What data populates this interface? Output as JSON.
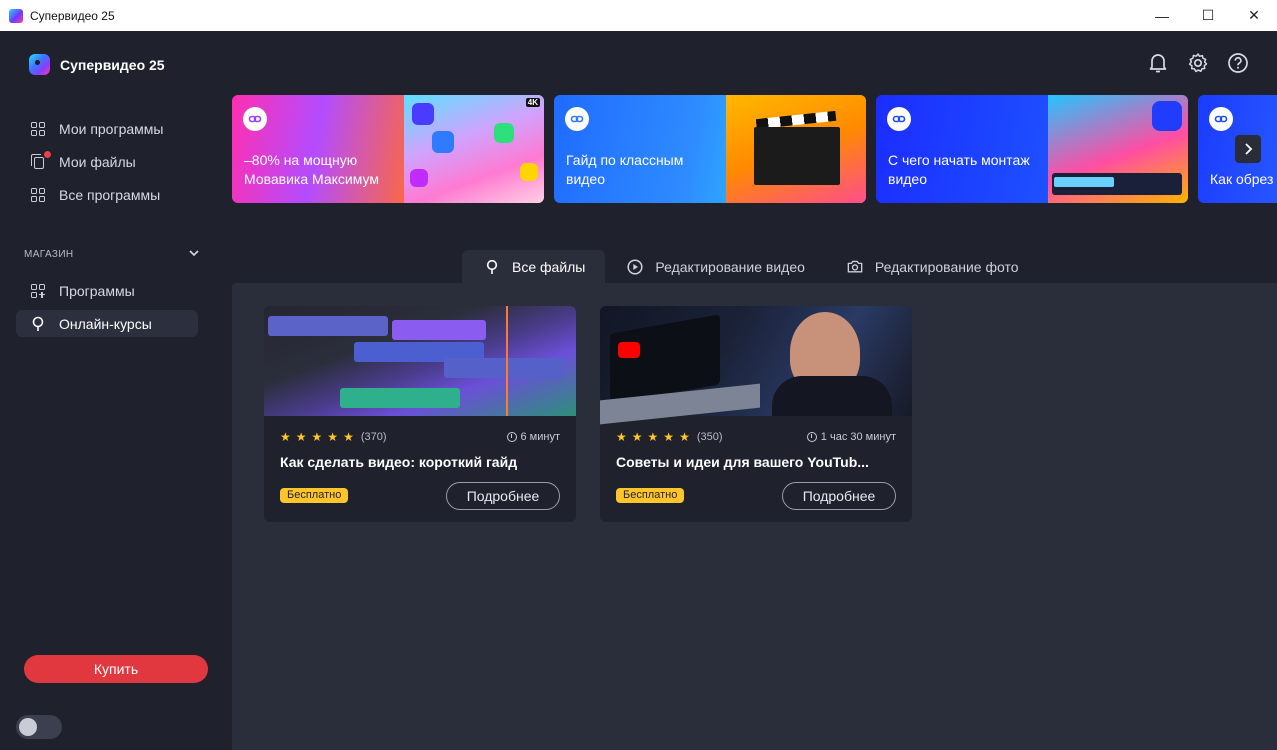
{
  "window": {
    "title": "Супервидео 25",
    "controls": {
      "minimize": "—",
      "maximize": "☐",
      "close": "✕"
    }
  },
  "brand": {
    "name": "Супервидео 25"
  },
  "sidebar": {
    "items": [
      {
        "label": "Мои программы",
        "icon": "grid-icon"
      },
      {
        "label": "Мои файлы",
        "icon": "files-icon",
        "has_notification": true
      },
      {
        "label": "Все программы",
        "icon": "grid-icon"
      }
    ],
    "store_section": {
      "label": "МАГАЗИН",
      "items": [
        {
          "label": "Программы",
          "icon": "grid-plus-icon"
        },
        {
          "label": "Онлайн-курсы",
          "icon": "lightbulb-icon",
          "active": true
        }
      ]
    },
    "buy_label": "Купить",
    "theme_toggle": {
      "on": false
    }
  },
  "header": {
    "icons": [
      "bell-icon",
      "gear-icon",
      "help-icon"
    ]
  },
  "banners": [
    {
      "text": "–80% на мощную Мовавика Максимум",
      "image_badge": "4K"
    },
    {
      "text": "Гайд по классным видео"
    },
    {
      "text": "С чего начать монтаж видео"
    },
    {
      "text": "Как обрез"
    }
  ],
  "tabs": [
    {
      "label": "Все файлы",
      "icon": "lightbulb-icon",
      "active": true
    },
    {
      "label": "Редактирование видео",
      "icon": "play-circle-icon"
    },
    {
      "label": "Редактирование фото",
      "icon": "camera-icon"
    }
  ],
  "courses": [
    {
      "title": "Как сделать видео: короткий гайд",
      "rating_stars": 5,
      "reviews": "(370)",
      "duration": "6 минут",
      "badge": "Бесплатно",
      "button": "Подробнее"
    },
    {
      "title": "Советы и идеи для вашего YouTub...",
      "rating_stars": 5,
      "reviews": "(350)",
      "duration": "1 час 30 минут",
      "badge": "Бесплатно",
      "button": "Подробнее"
    }
  ],
  "colors": {
    "accent_red": "#e1383f",
    "badge_yellow": "#ffc52a",
    "sidebar_bg": "#1f212c",
    "panel_bg": "#2a2d3a"
  }
}
